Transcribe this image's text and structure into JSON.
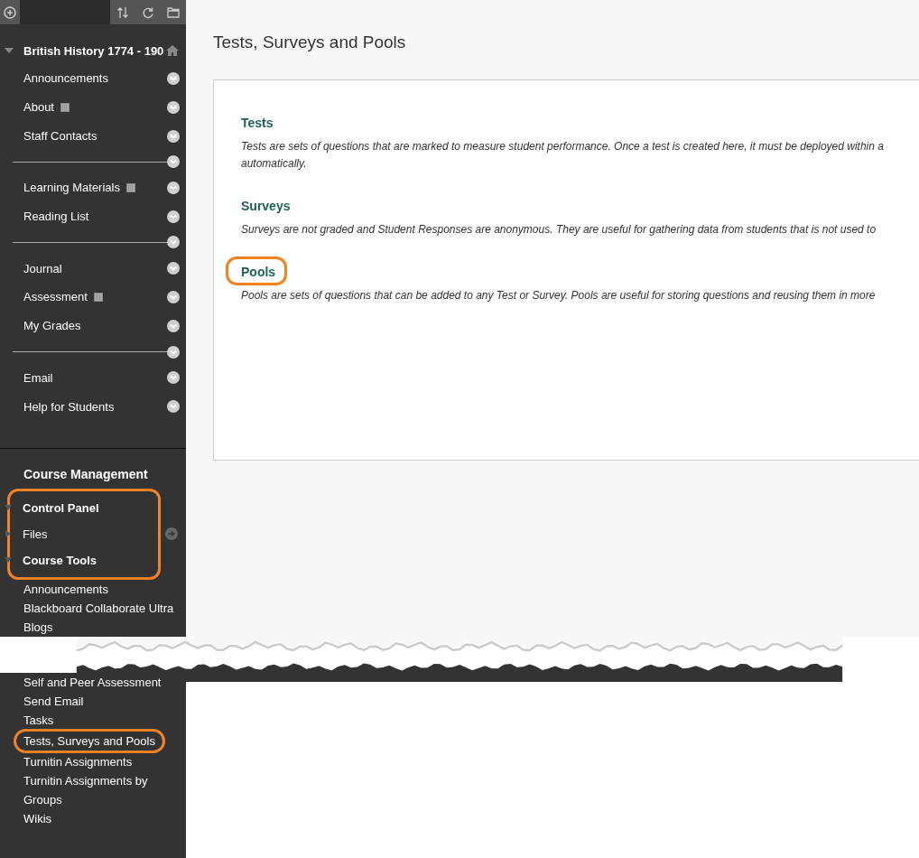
{
  "course": {
    "title": "British History 1774 - 190",
    "expanded": true
  },
  "menu": [
    {
      "kind": "link",
      "label": "Announcements",
      "has_page_icon": false
    },
    {
      "kind": "link",
      "label": "About",
      "has_page_icon": true
    },
    {
      "kind": "link",
      "label": "Staff Contacts",
      "has_page_icon": false
    },
    {
      "kind": "divider"
    },
    {
      "kind": "link",
      "label": "Learning Materials",
      "has_page_icon": true
    },
    {
      "kind": "link",
      "label": "Reading List",
      "has_page_icon": false
    },
    {
      "kind": "divider"
    },
    {
      "kind": "link",
      "label": "Journal",
      "has_page_icon": false
    },
    {
      "kind": "link",
      "label": "Assessment",
      "has_page_icon": true
    },
    {
      "kind": "link",
      "label": "My Grades",
      "has_page_icon": false
    },
    {
      "kind": "divider"
    },
    {
      "kind": "link",
      "label": "Email",
      "has_page_icon": false
    },
    {
      "kind": "link",
      "label": "Help for Students",
      "has_page_icon": false
    }
  ],
  "management": {
    "title": "Course Management",
    "group": {
      "highlighted": true,
      "items": [
        {
          "kind": "section",
          "label": "Control Panel",
          "expanded": true
        },
        {
          "kind": "tool",
          "label": "Files",
          "expanded": false
        },
        {
          "kind": "section",
          "label": "Course Tools",
          "expanded": true
        }
      ]
    },
    "tools_above": [
      {
        "label": "Announcements",
        "highlighted": false
      },
      {
        "label": "Blackboard Collaborate Ultra",
        "highlighted": false
      },
      {
        "label": "Blogs",
        "highlighted": false
      }
    ],
    "tools_below": [
      {
        "label": "Self and Peer Assessment",
        "highlighted": false
      },
      {
        "label": "Send Email",
        "highlighted": false
      },
      {
        "label": "Tasks",
        "highlighted": false
      },
      {
        "label": "Tests, Surveys and Pools",
        "highlighted": true
      },
      {
        "label": "Turnitin Assignments",
        "highlighted": false
      },
      {
        "label": "Turnitin Assignments by Groups",
        "highlighted": false
      },
      {
        "label": "Wikis",
        "highlighted": false
      }
    ]
  },
  "page_title": "Tests, Surveys and Pools",
  "sections": [
    {
      "title": "Tests",
      "highlighted": false,
      "description": "Tests are sets of questions that are marked to measure student performance. Once a test is created here, it must be deployed within a\nautomatically."
    },
    {
      "title": "Surveys",
      "highlighted": false,
      "description": "Surveys are not graded and Student Responses are anonymous. They are useful for gathering data from students that is not used to"
    },
    {
      "title": "Pools",
      "highlighted": true,
      "description": "Pools are sets of questions that can be added to any Test or Survey. Pools are useful for storing questions and reusing them in more"
    }
  ]
}
